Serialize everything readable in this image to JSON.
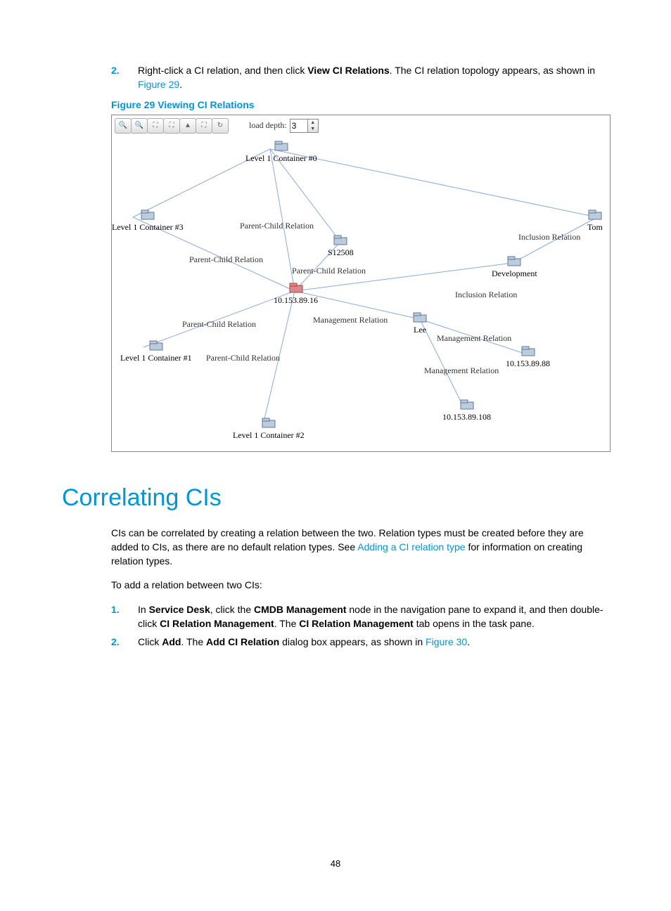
{
  "step2": {
    "num": "2.",
    "pre": "Right-click a CI relation, and then click ",
    "bold1": "View CI Relations",
    "post1": ". The CI relation topology appears, as shown in ",
    "link": "Figure 29",
    "post2": "."
  },
  "fig29_caption": "Figure 29 Viewing CI Relations",
  "toolbar": {
    "load_label": "load depth:",
    "depth_value": "3"
  },
  "nodes": {
    "lvl1_c0": "Level 1 Container #0",
    "lvl1_c3": "Level 1 Container #3",
    "tom": "Tom",
    "s12508": "S12508",
    "development": "Development",
    "ip1": "10.153.89.16",
    "lvl1_c1": "Level 1 Container #1",
    "lee": "Lee",
    "ip2": "10.153.89.88",
    "lvl1_c2": "Level 1 Container #2",
    "ip3": "10.153.89.108"
  },
  "edges": {
    "pcr": "Parent-Child Relation",
    "inc": "Inclusion Relation",
    "mgmt": "Management Relation"
  },
  "heading": "Correlating CIs",
  "para1": {
    "t1": "CIs can be correlated by creating a relation between the two. Relation types must be created before they are added to CIs, as there are no default relation types. See ",
    "link": "Adding a CI relation type",
    "t2": " for information on creating relation types."
  },
  "para2": "To add a relation between two CIs:",
  "step_b1": {
    "num": "1.",
    "t1": "In ",
    "b1": "Service Desk",
    "t2": ", click the ",
    "b2": "CMDB Management",
    "t3": " node in the navigation pane to expand it, and then double-click ",
    "b3": "CI Relation Management",
    "t4": ". The ",
    "b4": "CI Relation Management",
    "t5": " tab opens in the task pane."
  },
  "step_b2": {
    "num": "2.",
    "t1": "Click ",
    "b1": "Add",
    "t2": ". The ",
    "b2": "Add CI Relation",
    "t3": " dialog box appears, as shown in ",
    "link": "Figure 30",
    "t4": "."
  },
  "page_number": "48"
}
